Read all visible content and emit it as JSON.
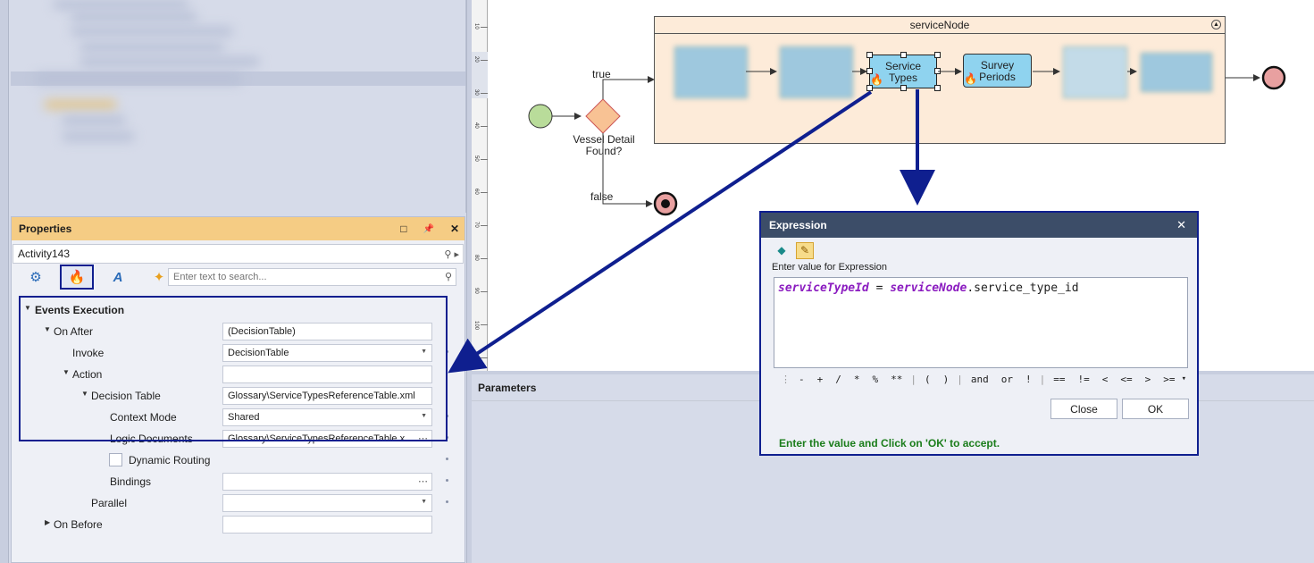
{
  "properties_panel": {
    "title": "Properties",
    "header_buttons": [
      "□",
      "📌",
      "✕"
    ],
    "object_name": "Activity143",
    "search_placeholder": "Enter text to search...",
    "rows": {
      "events_execution": "Events Execution",
      "on_after": {
        "label": "On After",
        "value": "(DecisionTable)"
      },
      "invoke": {
        "label": "Invoke",
        "value": "DecisionTable"
      },
      "action": {
        "label": "Action",
        "value": ""
      },
      "decision_table": {
        "label": "Decision Table",
        "value": "Glossary\\ServiceTypesReferenceTable.xml"
      },
      "context_mode": {
        "label": "Context Mode",
        "value": "Shared"
      },
      "logic_documents": {
        "label": "Logic Documents",
        "value": "Glossary\\ServiceTypesReferenceTable.x..."
      },
      "dynamic_routing": {
        "label": "Dynamic Routing"
      },
      "bindings": {
        "label": "Bindings",
        "value": ""
      },
      "parallel": {
        "label": "Parallel",
        "value": ""
      },
      "on_before": {
        "label": "On Before",
        "value": ""
      }
    }
  },
  "canvas": {
    "service_node_title": "serviceNode",
    "tasks": {
      "service_types": "Service Types",
      "survey_periods": "Survey Periods"
    },
    "gateway_label": "Vessel Detail Found?",
    "flow_true": "true",
    "flow_false": "false",
    "ruler_labels": [
      "10",
      "20",
      "30",
      "40",
      "50",
      "60",
      "70",
      "80",
      "90",
      "100",
      "110"
    ]
  },
  "parameters": {
    "title": "Parameters"
  },
  "expression_dialog": {
    "title": "Expression",
    "prompt": "Enter value for Expression",
    "expression": {
      "lhs": "serviceTypeId",
      "eq": " = ",
      "rhs_obj": "serviceNode",
      "rhs_field": ".service_type_id"
    },
    "operators": [
      "-",
      "+",
      "/",
      "*",
      "%",
      "**",
      "|",
      "(",
      ")",
      "|",
      "and",
      "or",
      "!",
      "|",
      "==",
      "!=",
      "<",
      "<=",
      ">",
      ">="
    ],
    "close_label": "Close",
    "ok_label": "OK",
    "hint": "Enter the value and Click on 'OK' to accept."
  },
  "colors": {
    "highlight": "#0f1f8f",
    "properties_header": "#f5cc84",
    "service_node_fill": "#fdebd9",
    "task_fill": "#8fd3ef",
    "keyword": "#8b1cc0",
    "hint": "#1b7d1b"
  }
}
